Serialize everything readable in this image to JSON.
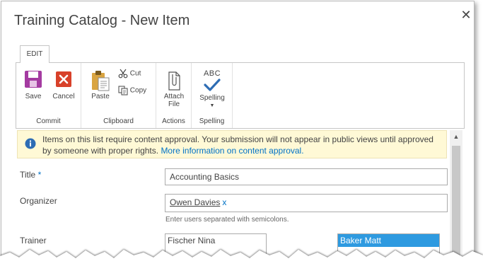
{
  "dialog": {
    "title": "Training Catalog - New Item",
    "close_icon": "close-icon"
  },
  "ribbon": {
    "tab": "EDIT",
    "groups": {
      "commit": {
        "label": "Commit",
        "save": "Save",
        "cancel": "Cancel"
      },
      "clipboard": {
        "label": "Clipboard",
        "paste": "Paste",
        "cut": "Cut",
        "copy": "Copy"
      },
      "actions": {
        "label": "Actions",
        "attach_line1": "Attach",
        "attach_line2": "File"
      },
      "spelling": {
        "label": "Spelling",
        "spelling": "Spelling",
        "abc": "ABC"
      }
    }
  },
  "notice": {
    "text": "Items on this list require content approval. Your submission will not appear in public views until approved by someone with proper rights.",
    "link": "More information on content approval."
  },
  "form": {
    "title": {
      "label": "Title",
      "required": "*",
      "value": "Accounting Basics"
    },
    "organizer": {
      "label": "Organizer",
      "person": "Owen Davies",
      "remove": "x",
      "hint": "Enter users separated with semicolons."
    },
    "trainer": {
      "label": "Trainer",
      "available": [
        "Fischer Nina"
      ],
      "selected": [
        "Baker Matt"
      ]
    }
  },
  "colors": {
    "accent": "#0072c6",
    "save_icon": "#a43ba1",
    "cancel_icon": "#d8412a",
    "notice_bg": "#fff9d6",
    "selected_item": "#2e9ae0"
  }
}
